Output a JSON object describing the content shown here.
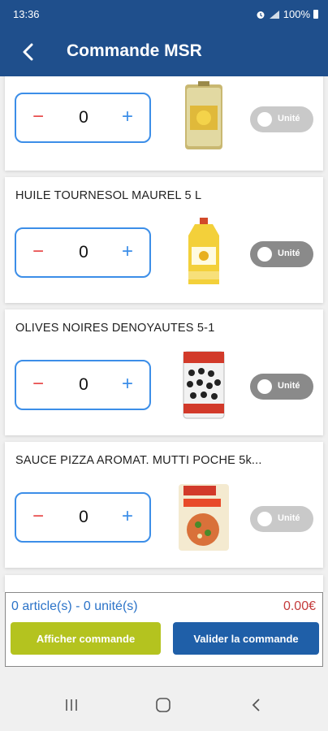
{
  "status_bar": {
    "time": "13:36",
    "battery": "100%",
    "icons": [
      "voicemail-icon",
      "alarm-icon",
      "wifi-calling-icon",
      "signal-icon",
      "battery-icon"
    ]
  },
  "header": {
    "title": "Commande MSR",
    "back_icon": "back-arrow-icon",
    "color": "#1f4f8c"
  },
  "products": [
    {
      "name": "",
      "quantity": "0",
      "unit_label": "Unité",
      "unit_enabled": false,
      "image": "oil-tin-can"
    },
    {
      "name": "HUILE TOURNESOL MAUREL 5 L",
      "quantity": "0",
      "unit_label": "Unité",
      "unit_enabled": true,
      "image": "sunflower-oil-bottle"
    },
    {
      "name": "OLIVES NOIRES DENOYAUTES 5-1",
      "quantity": "0",
      "unit_label": "Unité",
      "unit_enabled": true,
      "image": "olive-can"
    },
    {
      "name": "SAUCE PIZZA  AROMAT. MUTTI  POCHE 5k...",
      "quantity": "0",
      "unit_label": "Unité",
      "unit_enabled": false,
      "image": "pizza-sauce-pouch"
    }
  ],
  "stepper_icons": {
    "minus": "minus-icon",
    "plus": "plus-icon"
  },
  "footer": {
    "summary": "0 article(s) - 0 unité(s)",
    "total": "0.00€",
    "show_order_label": "Afficher commande",
    "validate_order_label": "Valider la commande"
  },
  "colors": {
    "primary": "#1f4f8c",
    "accent_blue": "#3c8ee8",
    "minus_red": "#e84a4a",
    "total_red": "#c43b3b",
    "show_button": "#b4c31f",
    "validate_button": "#1f5fa8"
  },
  "nav_bar": {
    "icons": [
      "recent-apps-icon",
      "home-icon",
      "nav-back-icon"
    ]
  }
}
